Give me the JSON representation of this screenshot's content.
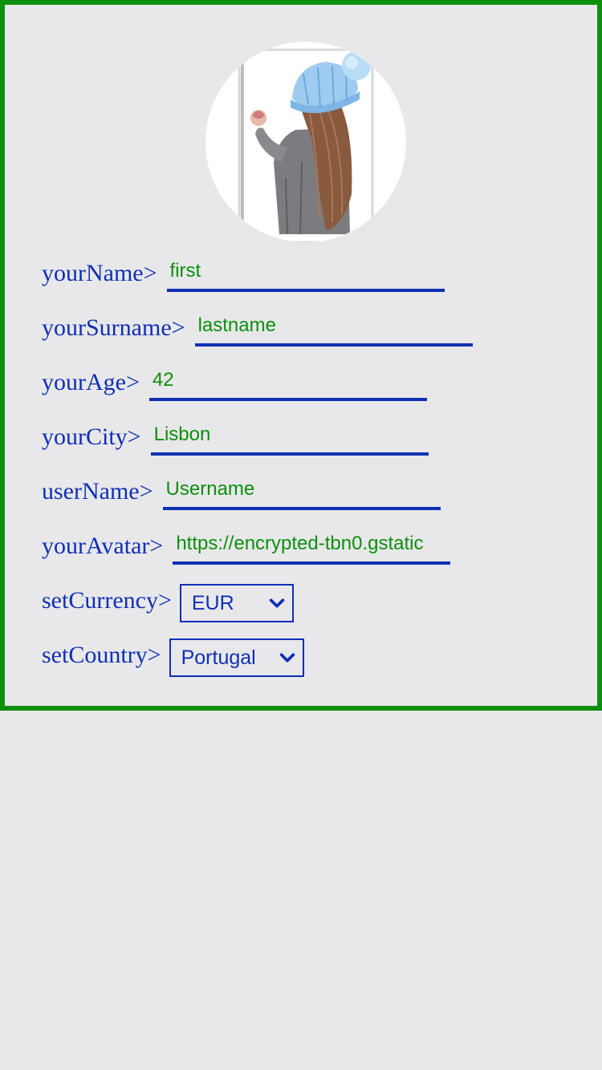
{
  "profile": {
    "avatar_alt": "avatar"
  },
  "form": {
    "name": {
      "label": "yourName>",
      "value": "first"
    },
    "surname": {
      "label": "yourSurname>",
      "value": "lastname"
    },
    "age": {
      "label": "yourAge>",
      "value": "42"
    },
    "city": {
      "label": "yourCity>",
      "value": "Lisbon"
    },
    "username": {
      "label": "userName>",
      "value": "Username"
    },
    "avatar": {
      "label": "yourAvatar>",
      "value": "https://encrypted-tbn0.gstatic"
    },
    "currency": {
      "label": "setCurrency>",
      "selected": "EUR"
    },
    "country": {
      "label": "setCountry>",
      "selected": "Portugal"
    }
  },
  "colors": {
    "border": "#0d8f0d",
    "label": "#0f2fb4",
    "value": "#0d8f0d",
    "background": "#e8e8ea"
  },
  "icons": {
    "dropdown": "chevron-down-icon"
  }
}
